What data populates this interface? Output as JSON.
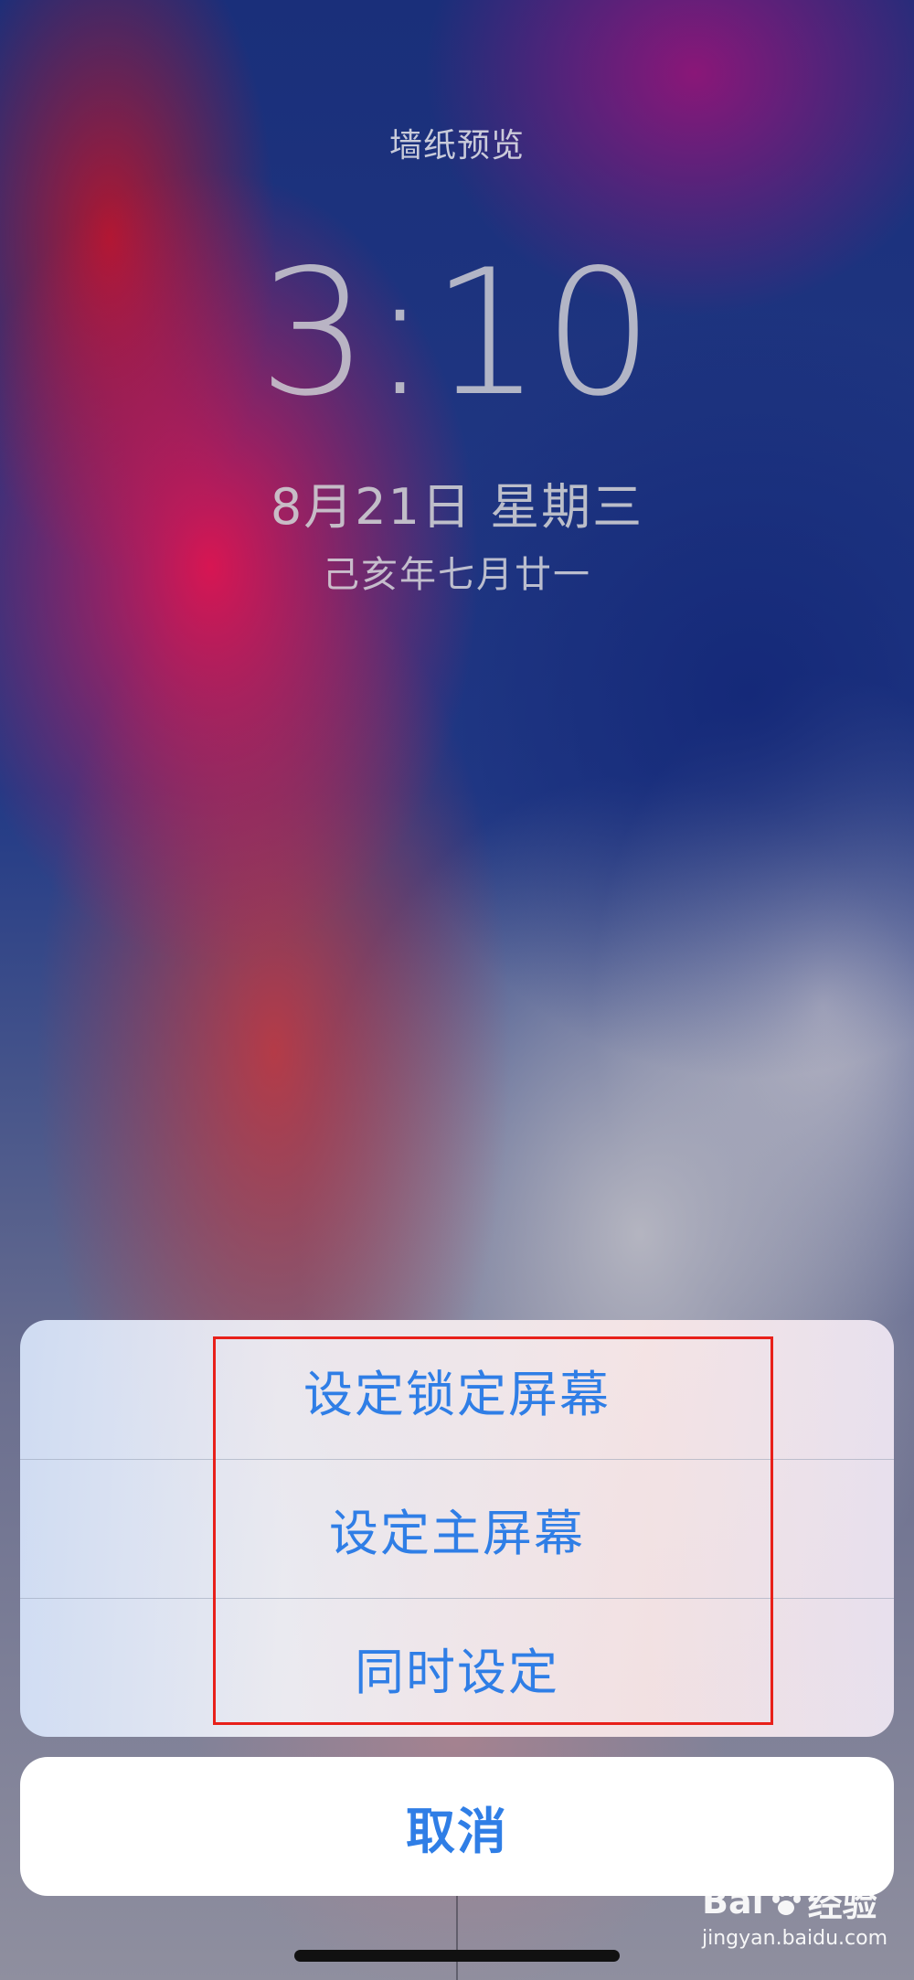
{
  "preview": {
    "title": "墙纸预览"
  },
  "lock_screen": {
    "time": "3:10",
    "date": "8月21日 星期三",
    "lunar_date": "己亥年七月廿一"
  },
  "action_sheet": {
    "options": [
      {
        "label": "设定锁定屏幕"
      },
      {
        "label": "设定主屏幕"
      },
      {
        "label": "同时设定"
      }
    ],
    "cancel_label": "取消"
  },
  "watermark": {
    "brand_left": "Bai",
    "brand_right": "经验",
    "url": "jingyan.baidu.com"
  },
  "colors": {
    "action_text": "#2f7ee6",
    "highlight_border": "#e8201a"
  }
}
